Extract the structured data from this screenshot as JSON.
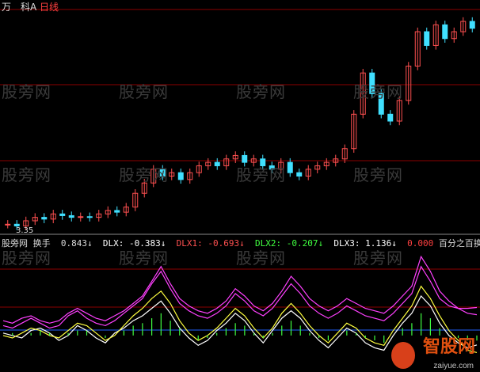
{
  "header": {
    "symbol_label": "万　科A",
    "timeframe": "日线"
  },
  "watermarks": [
    "股旁网",
    "股旁网",
    "股旁网",
    "股旁网",
    "股旁网",
    "股旁网",
    "股旁网",
    "股旁网",
    "股旁网",
    "股旁网",
    "股旁网",
    "股旁网"
  ],
  "price_axis_label": "3.35",
  "indicator": {
    "site": "股旁网",
    "name": "换手",
    "huanshou": "0.843↓",
    "dlx_label": "DLX:",
    "dlx": "-0.383↓",
    "dlx1_label": "DLX1:",
    "dlx1": "-0.693↓",
    "dlx2_label": "DLX2:",
    "dlx2": "-0.207↓",
    "dlx3_label": "DLX3:",
    "dlx3": "1.136↓",
    "extra": "0.000",
    "desc": "百分之百换手价"
  },
  "brand": {
    "name": "智股网",
    "url": "zaiyue.com"
  },
  "colors": {
    "up": "#ff5050",
    "down": "#40e0ff",
    "grid": "#8b0000",
    "dlx": "#ffffff",
    "dlx1": "#ffff40",
    "dlx2": "#40ff40",
    "dlx3": "#ff40ff"
  },
  "chart_data": {
    "type": "line",
    "series": [
      {
        "name": "换手",
        "values": [
          0.6,
          0.5,
          0.7,
          0.8,
          0.6,
          0.5,
          0.6,
          0.9,
          1.1,
          0.9,
          0.7,
          0.6,
          0.8,
          1.0,
          1.3,
          1.6,
          2.2,
          2.8,
          2.1,
          1.5,
          1.2,
          1.0,
          0.9,
          1.1,
          1.4,
          1.9,
          1.6,
          1.2,
          1.0,
          1.3,
          1.8,
          2.4,
          2.0,
          1.5,
          1.2,
          1.0,
          1.2,
          1.5,
          1.3,
          1.1,
          1.0,
          0.9,
          1.2,
          1.6,
          2.0,
          3.2,
          2.6,
          1.8,
          1.4,
          1.1,
          0.9,
          0.843
        ]
      },
      {
        "name": "DLX",
        "values": [
          0.1,
          0.0,
          -0.1,
          0.2,
          0.3,
          0.1,
          -0.2,
          0.0,
          0.4,
          0.2,
          -0.1,
          -0.3,
          0.1,
          0.3,
          0.6,
          0.8,
          1.1,
          1.4,
          0.9,
          0.3,
          -0.1,
          -0.4,
          -0.2,
          0.2,
          0.5,
          0.9,
          0.6,
          0.1,
          -0.3,
          0.2,
          0.7,
          1.0,
          0.7,
          0.2,
          -0.2,
          -0.5,
          -0.1,
          0.3,
          0.1,
          -0.3,
          -0.5,
          -0.6,
          0.0,
          0.5,
          0.9,
          1.6,
          1.2,
          0.5,
          0.0,
          -0.3,
          -0.5,
          -0.383
        ]
      },
      {
        "name": "DLX1",
        "values": [
          0.0,
          -0.1,
          0.1,
          0.3,
          0.2,
          0.0,
          -0.1,
          0.2,
          0.5,
          0.4,
          0.1,
          -0.2,
          0.0,
          0.4,
          0.8,
          1.1,
          1.5,
          1.8,
          1.3,
          0.6,
          0.1,
          -0.2,
          0.0,
          0.3,
          0.7,
          1.1,
          0.8,
          0.3,
          -0.1,
          0.3,
          0.9,
          1.3,
          0.9,
          0.4,
          0.0,
          -0.3,
          0.1,
          0.5,
          0.3,
          -0.1,
          -0.3,
          -0.4,
          0.2,
          0.7,
          1.2,
          2.0,
          1.5,
          0.8,
          0.2,
          -0.2,
          -0.6,
          -0.693
        ]
      },
      {
        "name": "DLX2",
        "values": [
          0.0,
          0.1,
          0.0,
          0.1,
          0.2,
          0.1,
          0.0,
          0.1,
          0.2,
          0.2,
          0.0,
          -0.1,
          0.0,
          0.2,
          0.4,
          0.5,
          0.7,
          0.9,
          0.6,
          0.3,
          0.0,
          -0.2,
          -0.1,
          0.1,
          0.3,
          0.5,
          0.4,
          0.1,
          -0.1,
          0.1,
          0.4,
          0.6,
          0.4,
          0.1,
          -0.1,
          -0.2,
          0.0,
          0.2,
          0.1,
          -0.1,
          -0.2,
          -0.3,
          0.0,
          0.3,
          0.5,
          0.9,
          0.7,
          0.3,
          0.0,
          -0.1,
          -0.2,
          -0.207
        ]
      },
      {
        "name": "DLX3",
        "values": [
          0.4,
          0.3,
          0.5,
          0.7,
          0.5,
          0.3,
          0.4,
          0.8,
          1.0,
          0.7,
          0.5,
          0.4,
          0.6,
          0.9,
          1.2,
          1.5,
          2.1,
          2.6,
          1.9,
          1.3,
          1.0,
          0.8,
          0.7,
          0.9,
          1.2,
          1.7,
          1.4,
          1.0,
          0.8,
          1.1,
          1.6,
          2.1,
          1.7,
          1.2,
          0.9,
          0.7,
          0.9,
          1.2,
          1.0,
          0.8,
          0.7,
          0.6,
          0.9,
          1.3,
          1.7,
          2.8,
          2.2,
          1.5,
          1.2,
          1.1,
          1.1,
          1.136
        ]
      }
    ],
    "price": [
      3.4,
      3.35,
      3.5,
      3.6,
      3.55,
      3.7,
      3.65,
      3.6,
      3.62,
      3.6,
      3.7,
      3.8,
      3.75,
      3.9,
      4.3,
      4.6,
      5.0,
      4.8,
      4.9,
      4.7,
      4.9,
      5.1,
      5.2,
      5.1,
      5.3,
      5.4,
      5.2,
      5.3,
      5.1,
      5.0,
      5.2,
      4.9,
      4.8,
      5.0,
      5.1,
      5.2,
      5.3,
      5.6,
      6.6,
      7.8,
      7.2,
      6.6,
      6.4,
      7.0,
      8.0,
      9.0,
      8.6,
      9.2,
      8.8,
      9.0,
      9.3,
      9.1
    ]
  }
}
